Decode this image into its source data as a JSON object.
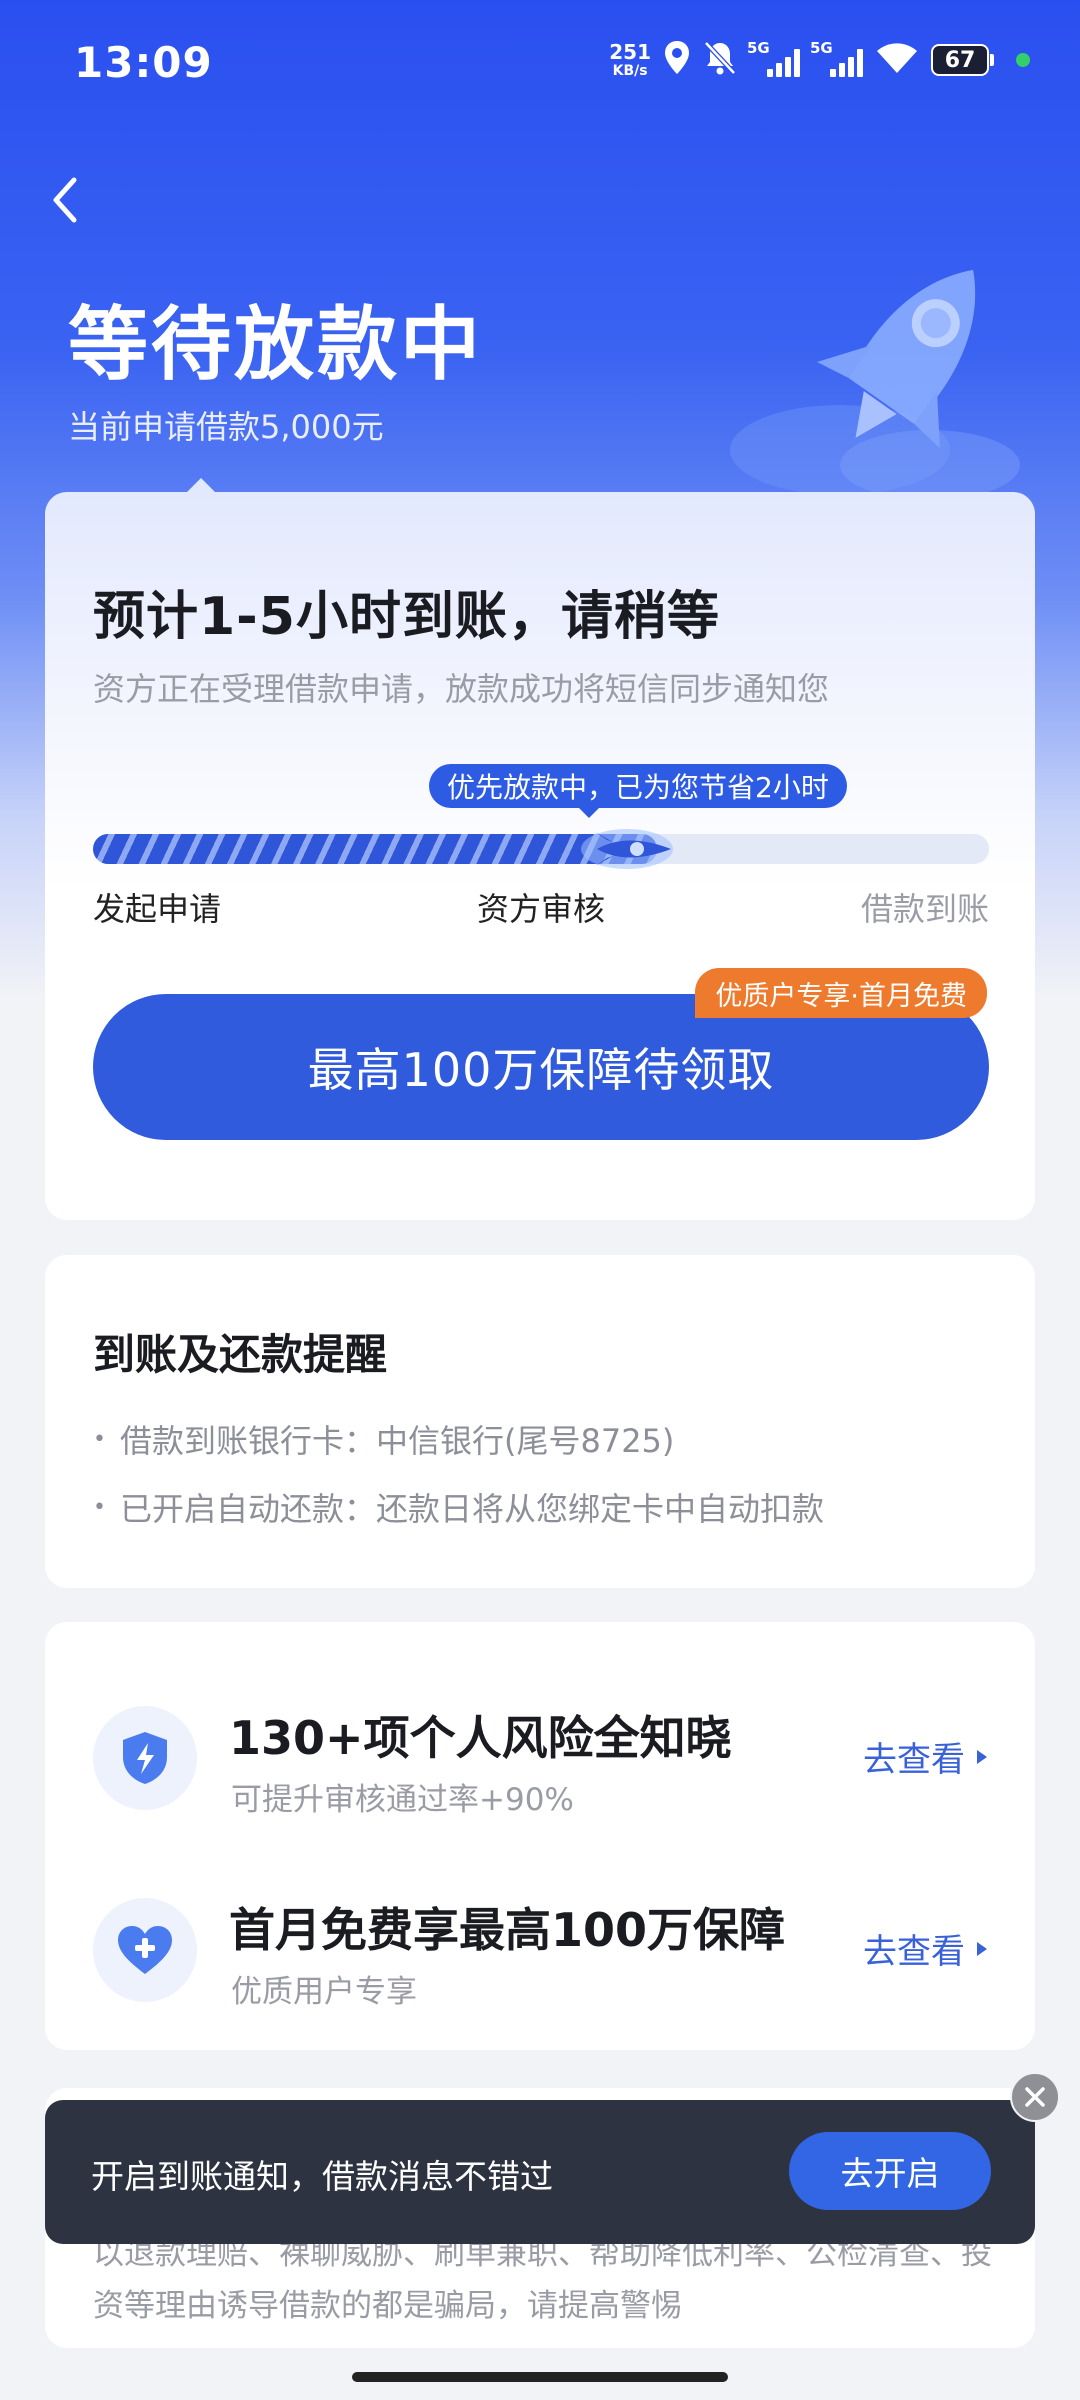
{
  "status_bar": {
    "time": "13:09",
    "net_speed": "251",
    "net_unit": "KB/s",
    "sim1_tag": "5G",
    "sim2_tag": "5G",
    "battery": "67",
    "icons": [
      "location-icon",
      "bell-off-icon",
      "signal-icon",
      "signal-icon",
      "wifi-icon",
      "battery-icon"
    ]
  },
  "header": {
    "title": "等待放款中",
    "subtitle": "当前申请借款5,000元"
  },
  "status_card": {
    "eta_title": "预计1-5小时到账，请稍等",
    "eta_desc": "资方正在受理借款申请，放款成功将短信同步通知您",
    "progress_tip": "优先放款中，已为您节省2小时",
    "progress_fraction": 0.63,
    "steps": [
      "发起申请",
      "资方审核",
      "借款到账"
    ],
    "cta_label": "最高100万保障待领取",
    "cta_badge": "优质户专享·首月免费"
  },
  "reminder": {
    "title": "到账及还款提醒",
    "items": [
      "借款到账银行卡：中信银行(尾号8725)",
      "已开启自动还款：还款日将从您绑定卡中自动扣款"
    ]
  },
  "services": [
    {
      "title": "130+项个人风险全知晓",
      "subtitle": "可提升审核通过率+90%",
      "link": "去查看",
      "icon": "shield-bolt-icon"
    },
    {
      "title": "首月免费享最高100万保障",
      "subtitle": "优质用户专享",
      "link": "去查看",
      "icon": "heart-plus-icon"
    }
  ],
  "warning": {
    "text": "以退款理赔、裸聊威胁、刷单兼职、帮助降低利率、公检清查、投资等理由诱导借款的都是骗局，请提高警惕"
  },
  "toast": {
    "text": "开启到账通知，借款消息不错过",
    "button": "去开启"
  },
  "colors": {
    "brand_blue": "#2f5bdc",
    "badge_orange": "#ee7a2d",
    "toast_bg": "#2d3340"
  }
}
